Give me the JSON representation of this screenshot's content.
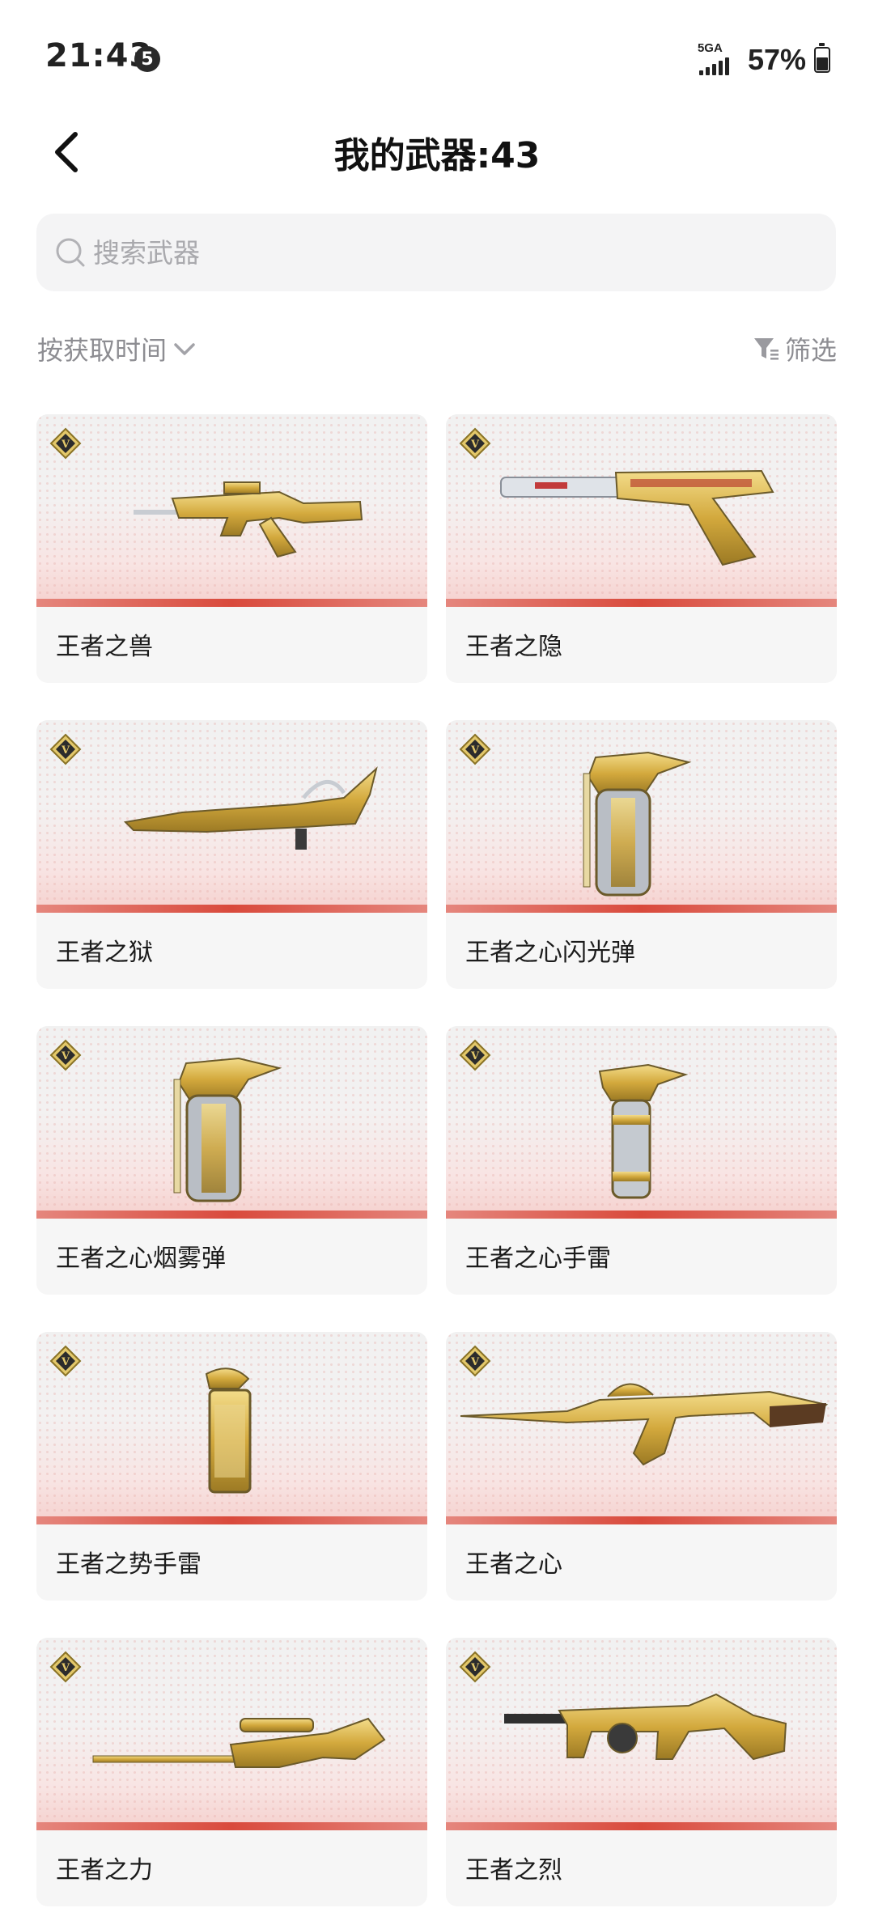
{
  "status_bar": {
    "time": "21:43",
    "notification_count": "5",
    "network": "5GA",
    "battery_percent": "57%",
    "battery_level": 0.57
  },
  "header": {
    "title": "我的武器:43",
    "back_icon": "chevron-left-icon"
  },
  "search": {
    "placeholder": "搜索武器",
    "value": "",
    "icon": "search-icon"
  },
  "sort": {
    "label": "按获取时间",
    "icon": "chevron-down-icon"
  },
  "filter": {
    "label": "筛选",
    "icon": "filter-icon"
  },
  "weapons": [
    {
      "name": "王者之兽",
      "type": "rifle"
    },
    {
      "name": "王者之隐",
      "type": "pistol"
    },
    {
      "name": "王者之狱",
      "type": "dragon-rifle"
    },
    {
      "name": "王者之心闪光弹",
      "type": "grenade-head"
    },
    {
      "name": "王者之心烟雾弹",
      "type": "grenade-head"
    },
    {
      "name": "王者之心手雷",
      "type": "grenade-small"
    },
    {
      "name": "王者之势手雷",
      "type": "grenade-canister"
    },
    {
      "name": "王者之心",
      "type": "ak"
    },
    {
      "name": "王者之力",
      "type": "sniper"
    },
    {
      "name": "王者之烈",
      "type": "tommy"
    }
  ],
  "colors": {
    "accent_red": "#d94a3c",
    "gold": "#d6b146",
    "text_secondary": "#8d8d92",
    "card_bg": "#f6f6f6"
  }
}
